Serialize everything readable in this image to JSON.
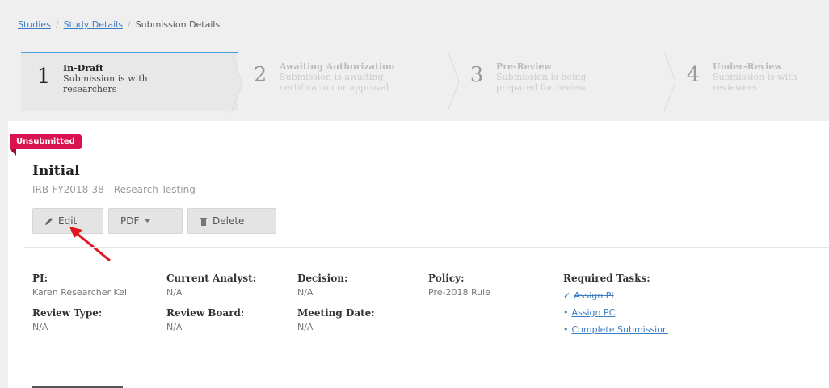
{
  "breadcrumb": {
    "studies": "Studies",
    "study_details": "Study Details",
    "current": "Submission Details"
  },
  "steps": [
    {
      "num": "1",
      "title": "In-Draft",
      "desc1": "Submission is with",
      "desc2": "researchers"
    },
    {
      "num": "2",
      "title": "Awaiting Authorization",
      "desc1": "Submission is awaiting",
      "desc2": "certification or approval"
    },
    {
      "num": "3",
      "title": "Pre-Review",
      "desc1": "Submission is being",
      "desc2": "prepared for review"
    },
    {
      "num": "4",
      "title": "Under-Review",
      "desc1": "Submission is with",
      "desc2": "reviewers"
    }
  ],
  "badge": "Unsubmitted",
  "heading": "Initial",
  "subheading": "IRB-FY2018-38 - Research Testing",
  "buttons": {
    "edit": "Edit",
    "pdf": "PDF",
    "delete": "Delete"
  },
  "fields": {
    "pi_label": "PI:",
    "pi_value": "Karen Researcher Keil",
    "analyst_label": "Current Analyst:",
    "analyst_value": "N/A",
    "decision_label": "Decision:",
    "decision_value": "N/A",
    "policy_label": "Policy:",
    "policy_value": "Pre-2018 Rule",
    "review_type_label": "Review Type:",
    "review_type_value": "N/A",
    "board_label": "Review Board:",
    "board_value": "N/A",
    "meeting_label": "Meeting Date:",
    "meeting_value": "N/A"
  },
  "tasks": {
    "label": "Required Tasks:",
    "items": [
      {
        "text": "Assign PI",
        "mark": "✓"
      },
      {
        "text": "Assign PC",
        "mark": "•"
      },
      {
        "text": "Complete Submission",
        "mark": "•"
      }
    ]
  },
  "colors": {
    "accent": "#4aa0d8",
    "badge": "#d8134f",
    "link": "#3b7cc4",
    "arrow": "#e0161e"
  }
}
